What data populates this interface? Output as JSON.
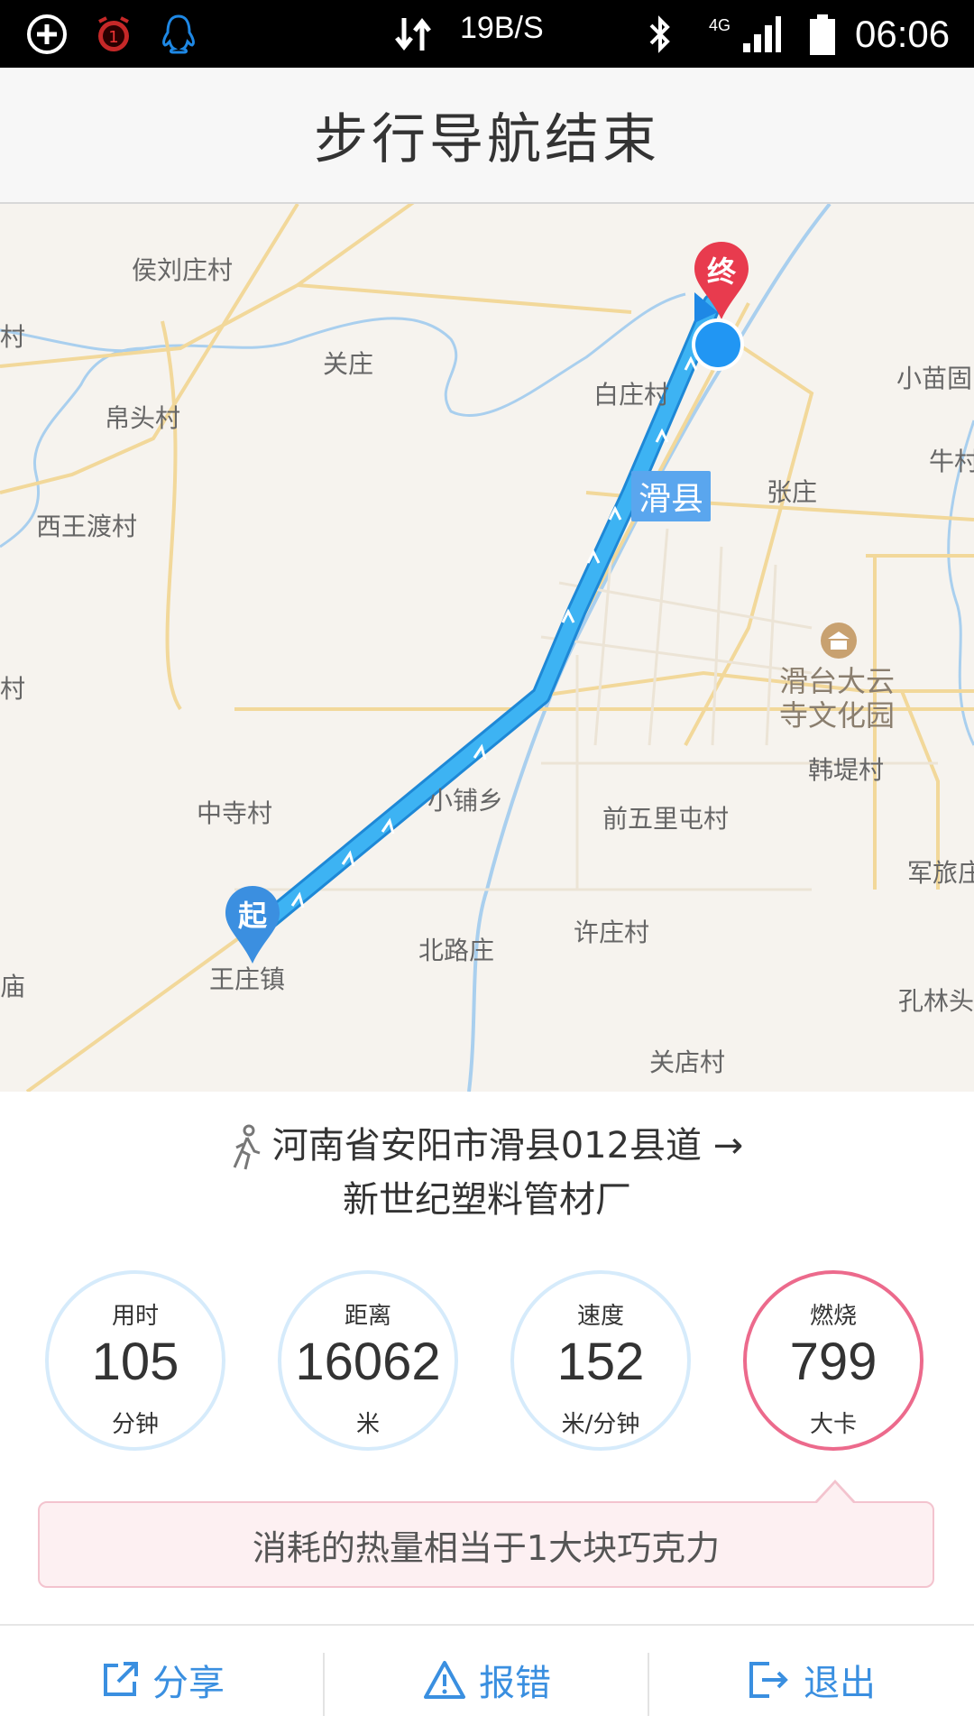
{
  "status_bar": {
    "net_speed": "19B/S",
    "network": "4G",
    "time": "06:06",
    "icons": [
      "add-circle-icon",
      "alarm-badge-icon",
      "qq-penguin-icon",
      "data-transfer-icon",
      "bluetooth-icon",
      "signal-icon",
      "battery-icon"
    ],
    "alarm_badge": "1"
  },
  "header": {
    "title": "步行导航结束"
  },
  "map": {
    "labels": [
      "侯刘庄村",
      "村",
      "关庄",
      "帛头村",
      "白庄村",
      "小苗固",
      "牛村",
      "西王渡村",
      "张庄",
      "滑台大云",
      "寺文化园",
      "村",
      "韩堤村",
      "小铺乡",
      "中寺村",
      "前五里屯村",
      "军旅庄",
      "王庄镇",
      "北路庄",
      "许庄村",
      "庙",
      "孔林头",
      "关店村"
    ],
    "city_badge": "滑县",
    "start_label": "起",
    "end_label": "终",
    "colors": {
      "route": "#2fa7ee",
      "start_pin": "#3b8fe0",
      "end_pin": "#e83b4e",
      "location_dot": "#2196f3"
    }
  },
  "route": {
    "from": "河南省安阳市滑县012县道",
    "arrow": "→",
    "to": "新世纪塑料管材厂"
  },
  "stats": [
    {
      "label": "用时",
      "value": "105",
      "unit": "分钟"
    },
    {
      "label": "距离",
      "value": "16062",
      "unit": "米"
    },
    {
      "label": "速度",
      "value": "152",
      "unit": "米/分钟"
    },
    {
      "label": "燃烧",
      "value": "799",
      "unit": "大卡"
    }
  ],
  "tip": "消耗的热量相当于1大块巧克力",
  "actions": {
    "share": "分享",
    "report": "报错",
    "exit": "退出"
  }
}
